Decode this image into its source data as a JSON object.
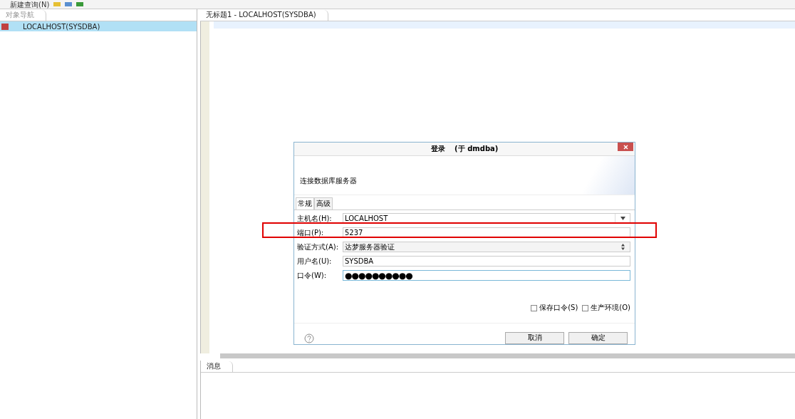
{
  "toolbar": {
    "new_query": "新建查询(N)"
  },
  "navigator": {
    "tab": "对象导航",
    "tree": [
      {
        "label": "LOCALHOST(SYSDBA)",
        "selected": true
      }
    ]
  },
  "editor": {
    "tab": "无标题1 - LOCALHOST(SYSDBA)"
  },
  "messages": {
    "tab": "消息"
  },
  "dialog": {
    "title": "登录",
    "subtitle": "(于 dmdba)",
    "heading": "连接数据库服务器",
    "tabs": [
      {
        "label": "常规",
        "selected": true
      },
      {
        "label": "高级",
        "selected": false
      }
    ],
    "fields": [
      {
        "kind": "combo",
        "label": "主机名(H):",
        "value": "LOCALHOST",
        "focused": false
      },
      {
        "kind": "text",
        "label": "端口(P):",
        "value": "5237",
        "focused": false,
        "highlighted": true
      },
      {
        "kind": "spinner",
        "label": "验证方式(A):",
        "value": "达梦服务器验证",
        "focused": false
      },
      {
        "kind": "text",
        "label": "用户名(U):",
        "value": "SYSDBA",
        "focused": false
      },
      {
        "kind": "password",
        "label": "口令(W):",
        "value": "●●●●●●●●●●",
        "focused": true
      }
    ],
    "checkboxes": [
      {
        "label": "保存口令(S)",
        "checked": false
      },
      {
        "label": "生产环境(O)",
        "checked": false
      }
    ],
    "buttons": [
      {
        "label": "取消"
      },
      {
        "label": "确定"
      }
    ]
  }
}
